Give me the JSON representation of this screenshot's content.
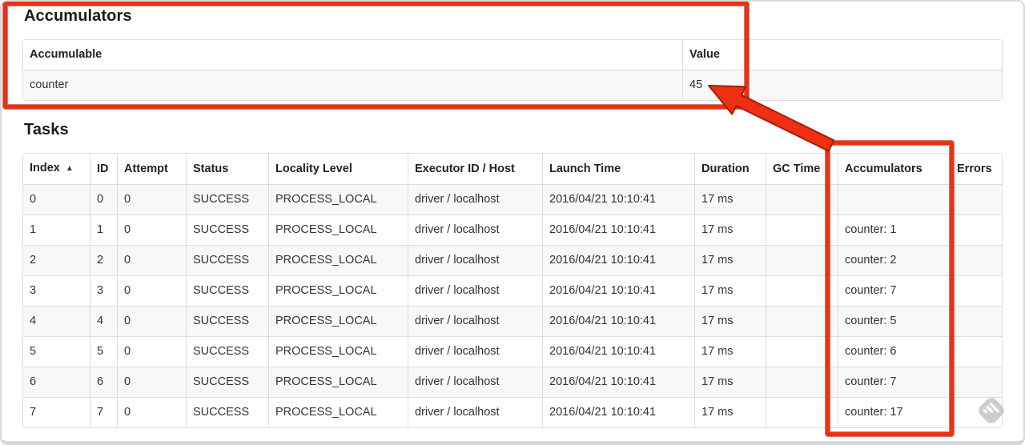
{
  "accumulators_section": {
    "title": "Accumulators",
    "table": {
      "headers": {
        "accumulable": "Accumulable",
        "value": "Value"
      },
      "row_keys": [
        "accumulable",
        "value"
      ],
      "rows": [
        {
          "accumulable": "counter",
          "value": "45"
        }
      ]
    }
  },
  "tasks_section": {
    "title": "Tasks",
    "table": {
      "headers": [
        "Index",
        "ID",
        "Attempt",
        "Status",
        "Locality Level",
        "Executor ID / Host",
        "Launch Time",
        "Duration",
        "GC Time",
        "Accumulators",
        "Errors"
      ],
      "sort_icon": "▲",
      "sorted_column": "Index",
      "row_keys": [
        "index",
        "id",
        "attempt",
        "status",
        "locality_level",
        "executor_id_host",
        "launch_time",
        "duration",
        "gc_time",
        "accumulators",
        "errors"
      ],
      "rows": [
        {
          "index": "0",
          "id": "0",
          "attempt": "0",
          "status": "SUCCESS",
          "locality_level": "PROCESS_LOCAL",
          "executor_id_host": "driver / localhost",
          "launch_time": "2016/04/21 10:10:41",
          "duration": "17 ms",
          "gc_time": "",
          "accumulators": "",
          "errors": ""
        },
        {
          "index": "1",
          "id": "1",
          "attempt": "0",
          "status": "SUCCESS",
          "locality_level": "PROCESS_LOCAL",
          "executor_id_host": "driver / localhost",
          "launch_time": "2016/04/21 10:10:41",
          "duration": "17 ms",
          "gc_time": "",
          "accumulators": "counter: 1",
          "errors": ""
        },
        {
          "index": "2",
          "id": "2",
          "attempt": "0",
          "status": "SUCCESS",
          "locality_level": "PROCESS_LOCAL",
          "executor_id_host": "driver / localhost",
          "launch_time": "2016/04/21 10:10:41",
          "duration": "17 ms",
          "gc_time": "",
          "accumulators": "counter: 2",
          "errors": ""
        },
        {
          "index": "3",
          "id": "3",
          "attempt": "0",
          "status": "SUCCESS",
          "locality_level": "PROCESS_LOCAL",
          "executor_id_host": "driver / localhost",
          "launch_time": "2016/04/21 10:10:41",
          "duration": "17 ms",
          "gc_time": "",
          "accumulators": "counter: 7",
          "errors": ""
        },
        {
          "index": "4",
          "id": "4",
          "attempt": "0",
          "status": "SUCCESS",
          "locality_level": "PROCESS_LOCAL",
          "executor_id_host": "driver / localhost",
          "launch_time": "2016/04/21 10:10:41",
          "duration": "17 ms",
          "gc_time": "",
          "accumulators": "counter: 5",
          "errors": ""
        },
        {
          "index": "5",
          "id": "5",
          "attempt": "0",
          "status": "SUCCESS",
          "locality_level": "PROCESS_LOCAL",
          "executor_id_host": "driver / localhost",
          "launch_time": "2016/04/21 10:10:41",
          "duration": "17 ms",
          "gc_time": "",
          "accumulators": "counter: 6",
          "errors": ""
        },
        {
          "index": "6",
          "id": "6",
          "attempt": "0",
          "status": "SUCCESS",
          "locality_level": "PROCESS_LOCAL",
          "executor_id_host": "driver / localhost",
          "launch_time": "2016/04/21 10:10:41",
          "duration": "17 ms",
          "gc_time": "",
          "accumulators": "counter: 7",
          "errors": ""
        },
        {
          "index": "7",
          "id": "7",
          "attempt": "0",
          "status": "SUCCESS",
          "locality_level": "PROCESS_LOCAL",
          "executor_id_host": "driver / localhost",
          "launch_time": "2016/04/21 10:10:41",
          "duration": "17 ms",
          "gc_time": "",
          "accumulators": "counter: 17",
          "errors": ""
        }
      ]
    }
  },
  "annotations": {
    "highlight_color": "#ee2f12",
    "arrow_points_to_value": "45",
    "boxed_regions": [
      "accumulators-summary-table",
      "tasks-accumulators-column"
    ]
  },
  "icons": {
    "sort_ascending": "▲",
    "watermark": "skitch-diamond"
  }
}
